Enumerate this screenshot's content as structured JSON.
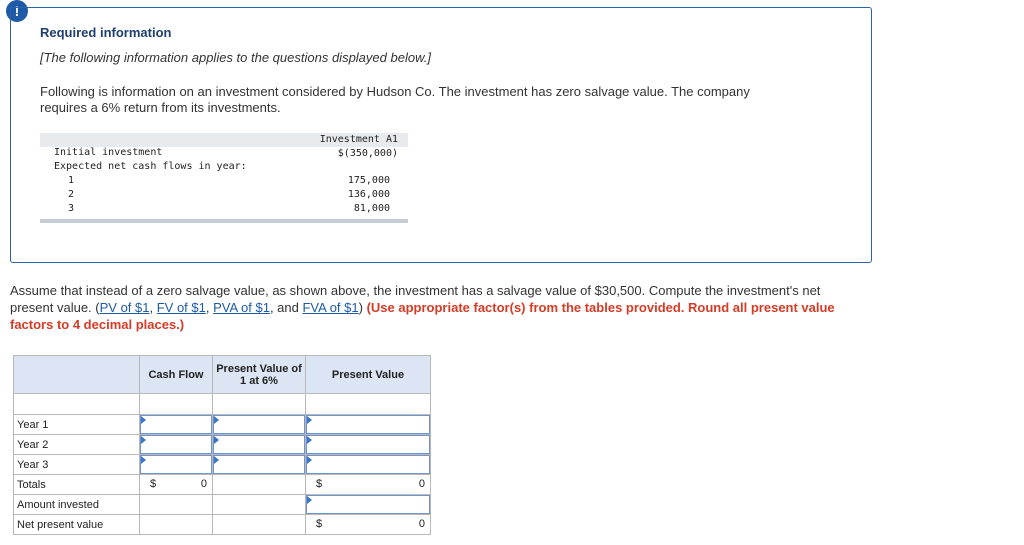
{
  "alert_icon": "!",
  "info": {
    "title": "Required information",
    "subtitle": "[The following information applies to the questions displayed below.]",
    "description": "Following is information on an investment considered by Hudson Co. The investment has zero salvage value. The company requires a 6% return from its investments."
  },
  "data_table": {
    "header_line1": "Investment A1",
    "header_line2": "$(350,000)",
    "initial_label": "Initial investment",
    "cash_flows_label": "Expected net cash flows in year:",
    "rows": [
      {
        "year": "1",
        "value": "175,000"
      },
      {
        "year": "2",
        "value": "136,000"
      },
      {
        "year": "3",
        "value": "81,000"
      }
    ]
  },
  "question": {
    "text_before": "Assume that instead of a zero salvage value, as shown above, the investment has a salvage value of $30,500. Compute the investment's net present value. (",
    "links": [
      "PV of $1",
      "FV of $1",
      "PVA of $1",
      "FVA of $1"
    ],
    "sep1": ", ",
    "sep2": ", ",
    "sep3": ", and ",
    "text_after": ") ",
    "red_text": "(Use appropriate factor(s) from the tables provided. Round all present value factors to 4 decimal places.)"
  },
  "calc_table": {
    "headers": {
      "cash_flow": "Cash Flow",
      "pv_factor": "Present Value of 1 at 6%",
      "present_value": "Present Value"
    },
    "rows": {
      "year1": "Year 1",
      "year2": "Year 2",
      "year3": "Year 3",
      "totals": "Totals",
      "amount_invested": "Amount invested",
      "npv": "Net present value"
    },
    "dollar": "$",
    "totals_cash_flow": "0",
    "totals_present_value": "0",
    "npv_value": "0"
  }
}
